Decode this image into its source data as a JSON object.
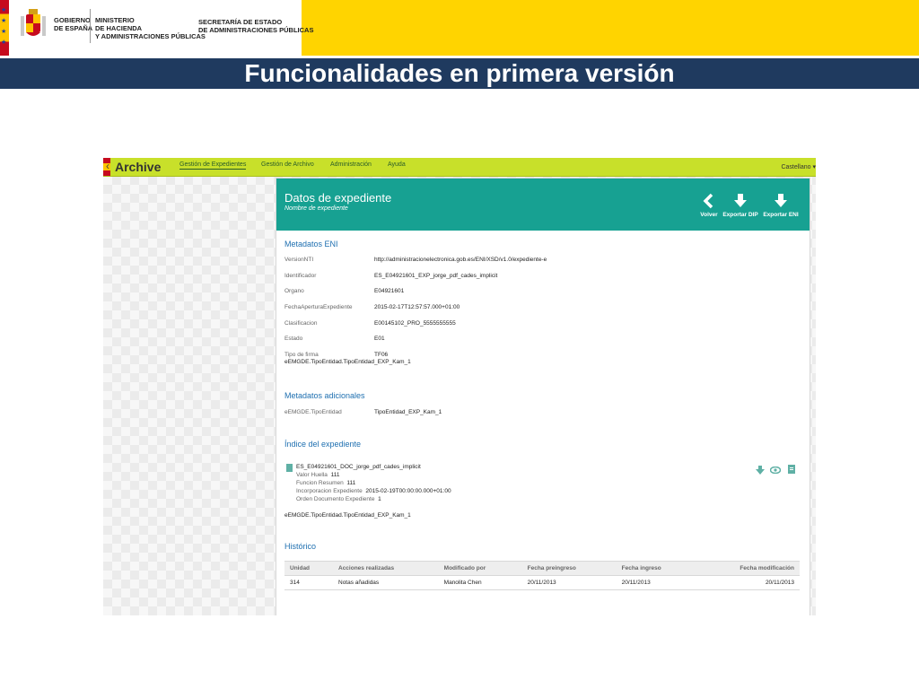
{
  "gov_header": {
    "gobierno": [
      "GOBIERNO",
      "DE ESPAÑA"
    ],
    "ministerio": [
      "MINISTERIO",
      "DE HACIENDA",
      "Y ADMINISTRACIONES PÚBLICAS"
    ],
    "secretaria": [
      "SECRETARÍA DE ESTADO",
      "DE ADMINISTRACIONES PÚBLICAS"
    ],
    "colors": {
      "band": "#ffd400",
      "title_bar": "#1f3a5f"
    }
  },
  "slide_title": "Funcionalidades en primera versión",
  "app": {
    "brand": "Archive",
    "nav": [
      "Gestión de Expedientes",
      "Gestión de Archivo",
      "Administración",
      "Ayuda"
    ],
    "language": "Castellano ▾",
    "colors": {
      "nav": "#c8e02a",
      "header": "#17a192"
    },
    "panel": {
      "title": "Datos de expediente",
      "subtitle": "Nombre de expediente",
      "buttons": [
        "Volver",
        "Exportar DIP",
        "Exportar ENI"
      ],
      "eni": {
        "heading": "Metadatos ENI",
        "rows": [
          {
            "label": "VersionNTI",
            "value": "http://administracionelectronica.gob.es/ENI/XSD/v1.0/expediente-e"
          },
          {
            "label": "Identificador",
            "value": "ES_E04921601_EXP_jorge_pdf_cades_implicit"
          },
          {
            "label": "Organo",
            "value": "E04921601"
          },
          {
            "label": "FechaAperturaExpediente",
            "value": "2015-02-17T12:57:57.000+01:00"
          },
          {
            "label": "Clasificacion",
            "value": "E00145102_PRO_5555555555"
          },
          {
            "label": "Estado",
            "value": "E01"
          },
          {
            "label": "Tipo de firma",
            "value": "TF06"
          }
        ],
        "extra": "eEMGDE.TipoEntidad.TipoEntidad_EXP_Kam_1"
      },
      "adicionales": {
        "heading": "Metadatos adicionales",
        "label": "eEMGDE.TipoEntidad",
        "value": "TipoEntidad_EXP_Kam_1"
      },
      "indice": {
        "heading": "Índice del expediente",
        "doc_name": "ES_E04921601_DOC_jorge_pdf_cades_implicit",
        "details": [
          {
            "label": "Valor Huella",
            "value": "111"
          },
          {
            "label": "Funcion Resumen",
            "value": "111"
          },
          {
            "label": "Incorporacion Expediente",
            "value": "2015-02-19T00:00:00.000+01:00"
          },
          {
            "label": "Orden Documento Expediente",
            "value": "1"
          }
        ],
        "extra": "eEMGDE.TipoEntidad.TipoEntidad_EXP_Kam_1"
      },
      "historico": {
        "heading": "Histórico",
        "columns": [
          "Unidad",
          "Acciones realizadas",
          "Modificado por",
          "Fecha preingreso",
          "Fecha ingreso",
          "Fecha modificación"
        ],
        "rows": [
          [
            "314",
            "Notas añadidas",
            "Manolita Chen",
            "20/11/2013",
            "20/11/2013",
            "20/11/2013"
          ]
        ]
      }
    }
  }
}
